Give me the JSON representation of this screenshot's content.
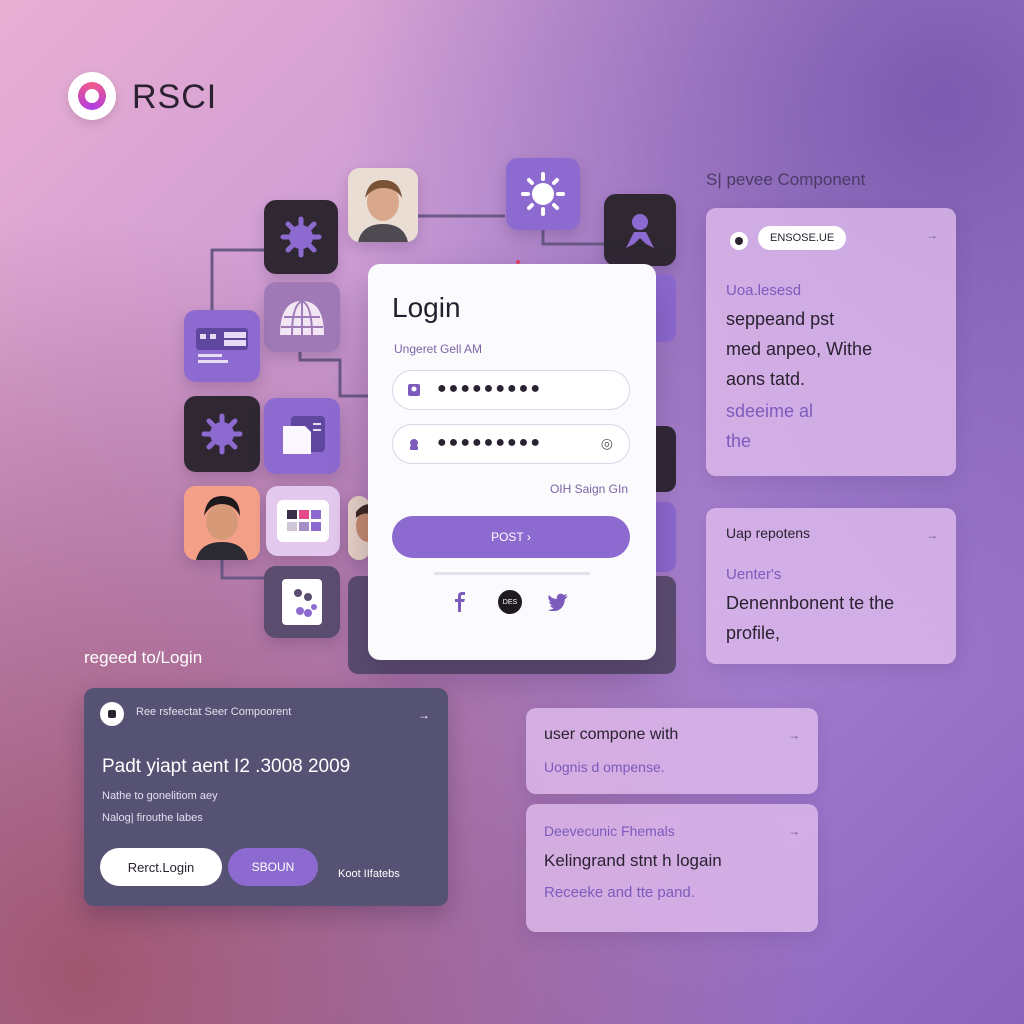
{
  "brand": {
    "name": "RSCI"
  },
  "login": {
    "title": "Login",
    "subtitle": "Ungeret Gell AM",
    "field1_dots": "●●●●●●●●●",
    "field2_dots": "●●●●●●●●●",
    "forgot": "OIH Saign GIn",
    "submit": "POST ›",
    "social_middle": "DES"
  },
  "right_panel": {
    "heading": "S| pevee Component",
    "card1": {
      "pill": "ENSOSE.UE",
      "line1": "Uoa.lesesd",
      "line2": "seppeand pst",
      "line3": "med anpeo, Withe",
      "line4": "aons tatd.",
      "line5": "sdeeime al",
      "line6": "the"
    },
    "card2": {
      "title": "Uap repotens",
      "line1": "Uenter's",
      "line2": "Denennbonent te the",
      "line3": "profile,"
    }
  },
  "bottom_left": {
    "label": "regeed to/Login",
    "card": {
      "header": "Ree rsfeectat Seer Compoorent",
      "big": "Padt yiapt aent I2 .3008 2009",
      "line1": "Nathe to gonelitiom aey",
      "line2": "Nalog| firouthe labes",
      "btn1": "Rerct.Login",
      "btn2": "SBOUN",
      "link": "Koot IIfatebs"
    }
  },
  "mid_cards": {
    "card1": {
      "title": "user compone with",
      "sub": "Uognis d ompense."
    },
    "card2": {
      "line1": "Deevecunic Fhemals",
      "line2": "Kelingrand stnt h logain",
      "line3": "Receeke and tte pand."
    }
  },
  "arrows": {
    "symbol": "→"
  },
  "colors": {
    "accent": "#8d6ad0",
    "dark_tile": "#2f2833",
    "card_dark": "#565274"
  }
}
